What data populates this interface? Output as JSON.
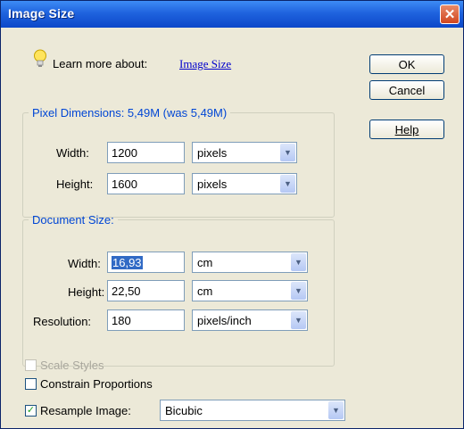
{
  "window": {
    "title": "Image Size",
    "close_glyph": "✕"
  },
  "learn": {
    "prefix": "Learn more about:",
    "link": "Image Size",
    "icon": "lightbulb-icon"
  },
  "buttons": {
    "ok": "OK",
    "cancel": "Cancel",
    "help": "Help"
  },
  "pixel_dimensions": {
    "legend": "Pixel Dimensions: 5,49M (was 5,49M)",
    "width": {
      "label": "Width:",
      "value": "1200",
      "unit": "pixels"
    },
    "height": {
      "label": "Height:",
      "value": "1600",
      "unit": "pixels"
    }
  },
  "document_size": {
    "legend": "Document Size:",
    "width": {
      "label": "Width:",
      "value": "16,93",
      "unit": "cm"
    },
    "height": {
      "label": "Height:",
      "value": "22,50",
      "unit": "cm"
    },
    "resolution": {
      "label": "Resolution:",
      "value": "180",
      "unit": "pixels/inch"
    }
  },
  "options": {
    "scale_styles": {
      "label": "Scale Styles",
      "checked": false,
      "enabled": false
    },
    "constrain": {
      "label": "Constrain Proportions",
      "checked": false
    },
    "resample": {
      "label": "Resample Image:",
      "checked": true,
      "method": "Bicubic"
    }
  },
  "icons": {
    "check": "✓",
    "dropdown": "▼"
  }
}
